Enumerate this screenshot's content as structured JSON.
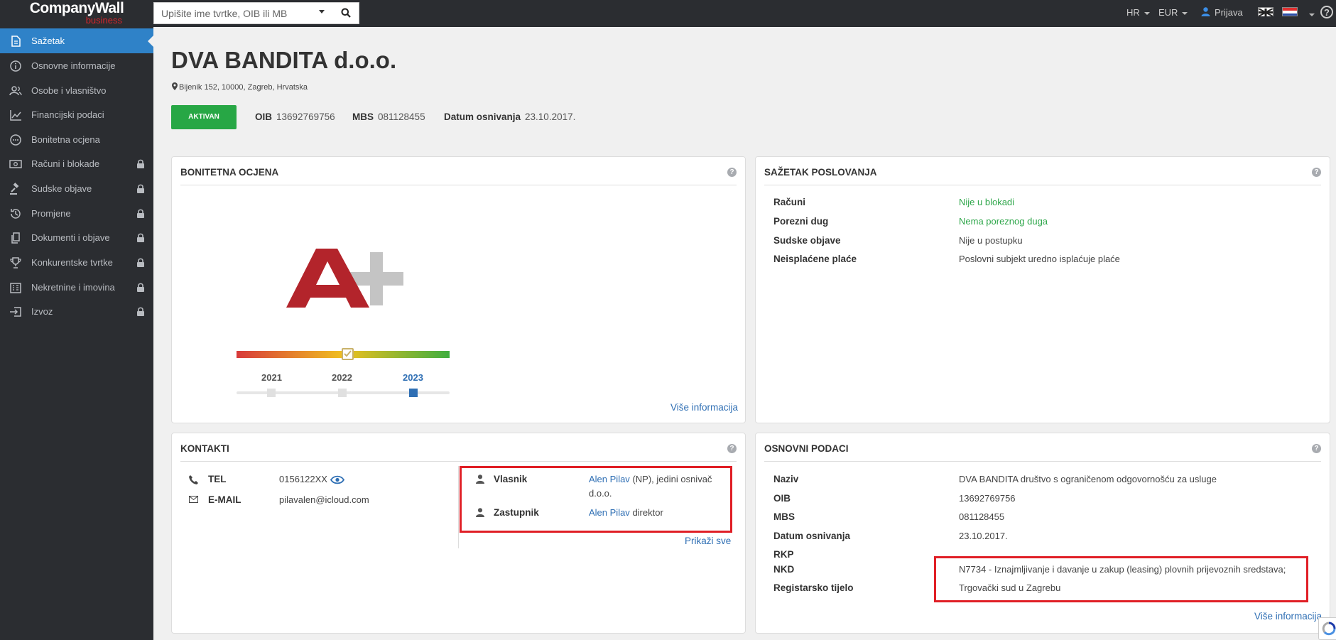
{
  "topbar": {
    "logo_main": "CompanyWall",
    "logo_sub": "business",
    "search_placeholder": "Upišite ime tvrtke, OIB ili MB",
    "language": "HR",
    "currency": "EUR",
    "login_label": "Prijava",
    "help_label": "?"
  },
  "sidebar": {
    "items": [
      {
        "label": "Sažetak"
      },
      {
        "label": "Osnovne informacije"
      },
      {
        "label": "Osobe i vlasništvo"
      },
      {
        "label": "Financijski podaci"
      },
      {
        "label": "Bonitetna ocjena"
      },
      {
        "label": "Računi i blokade"
      },
      {
        "label": "Sudske objave"
      },
      {
        "label": "Promjene"
      },
      {
        "label": "Dokumenti i objave"
      },
      {
        "label": "Konkurentske tvrtke"
      },
      {
        "label": "Nekretnine i imovina"
      },
      {
        "label": "Izvoz"
      }
    ]
  },
  "company": {
    "name": "DVA BANDITA d.o.o.",
    "address": "Bijenik 152, 10000, Zagreb, Hrvatska",
    "status": "AKTIVAN",
    "oib_label": "OIB",
    "oib": "13692769756",
    "mbs_label": "MBS",
    "mbs": "081128455",
    "founded_label": "Datum osnivanja",
    "founded": "23.10.2017."
  },
  "rating_card": {
    "title": "BONITETNA OCJENA",
    "grade": "A+",
    "grade_level": 0.52,
    "years": [
      "2021",
      "2022",
      "2023"
    ],
    "selected_year": "2023",
    "more_link": "Više informacija"
  },
  "summary_card": {
    "title": "SAŽETAK POSLOVANJA",
    "rows": [
      {
        "label": "Računi",
        "value": "Nije u blokadi",
        "status": "green"
      },
      {
        "label": "Porezni dug",
        "value": "Nema poreznog duga",
        "status": "green"
      },
      {
        "label": "Sudske objave",
        "value": "Nije u postupku",
        "status": "neutral"
      },
      {
        "label": "Neisplaćene plaće",
        "value": "Poslovni subjekt uredno isplaćuje plaće",
        "status": "neutral"
      }
    ]
  },
  "contacts_card": {
    "title": "KONTAKTI",
    "tel_label": "TEL",
    "tel": "0156122XX",
    "email_label": "E-MAIL",
    "email": "pilavalen@icloud.com",
    "owner_label": "Vlasnik",
    "owner_name": "Alen Pilav",
    "owner_desc_1": "(NP), jedini osnivač",
    "owner_desc_2": "d.o.o.",
    "rep_label": "Zastupnik",
    "rep_name": "Alen Pilav",
    "rep_desc": "direktor",
    "show_all": "Prikaži sve"
  },
  "basic_card": {
    "title": "OSNOVNI PODACI",
    "rows": [
      {
        "label": "Naziv",
        "value": "DVA BANDITA društvo s ograničenom odgovornošću za usluge"
      },
      {
        "label": "OIB",
        "value": "13692769756"
      },
      {
        "label": "MBS",
        "value": "081128455"
      },
      {
        "label": "Datum osnivanja",
        "value": "23.10.2017."
      },
      {
        "label": "RKP",
        "value": ""
      },
      {
        "label": "NKD",
        "value": "N7734 - Iznajmljivanje i davanje u zakup (leasing) plovnih prijevoznih sredstava;"
      },
      {
        "label": "Registarsko tijelo",
        "value": "Trgovački sud u Zagrebu"
      }
    ],
    "more_link": "Više informacija"
  },
  "colors": {
    "sidebar_bg": "#2b2d31",
    "active": "#2f82c8",
    "status_green": "#27a745",
    "link_blue": "#2f6fb4",
    "grade_red": "#b3242b",
    "highlight_red": "#e01f26"
  }
}
